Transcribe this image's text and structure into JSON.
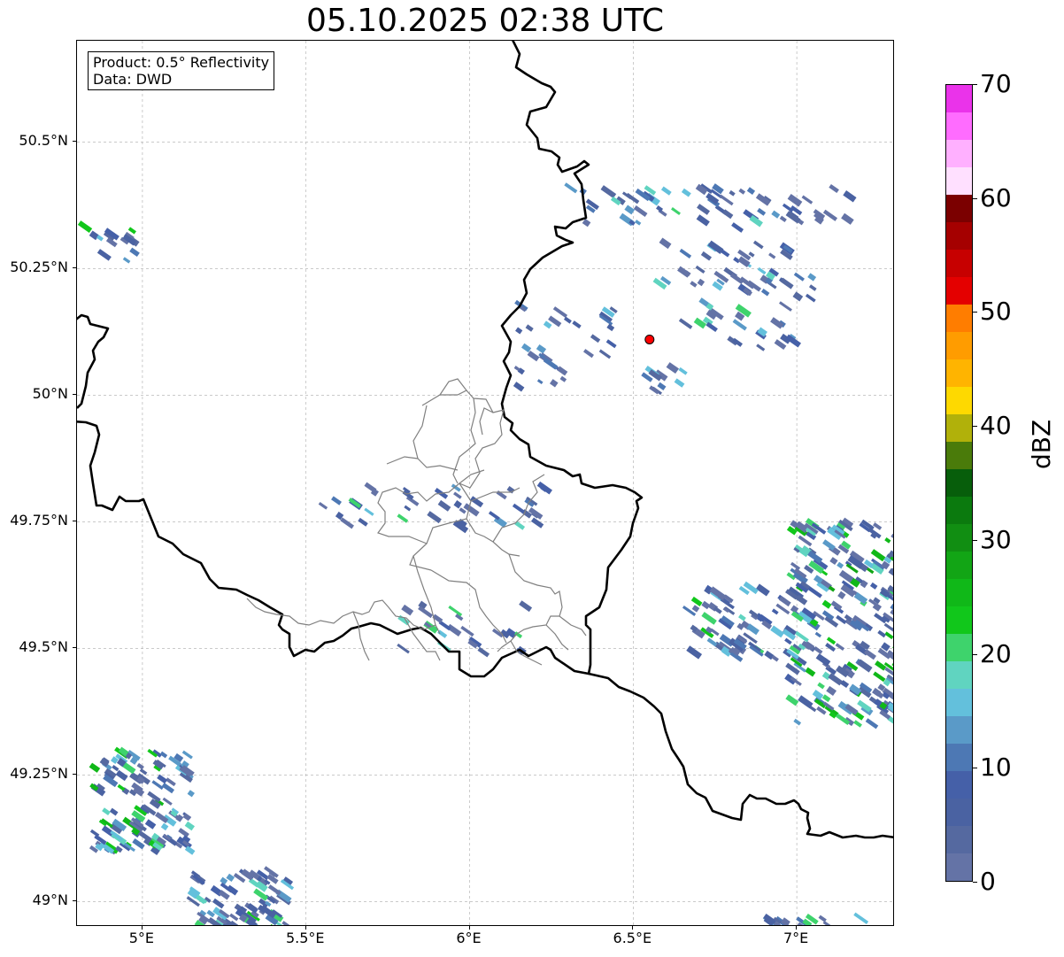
{
  "title": "05.10.2025 02:38 UTC",
  "info_box": {
    "product": "Product: 0.5° Reflectivity",
    "data": "Data: DWD"
  },
  "map_extent": {
    "lon_min": 4.8,
    "lon_max": 7.3,
    "lat_min": 48.95,
    "lat_max": 50.7
  },
  "lat_ticks": [
    {
      "value": 50.5,
      "label": "50.5°N"
    },
    {
      "value": 50.25,
      "label": "50.25°N"
    },
    {
      "value": 50.0,
      "label": "50°N"
    },
    {
      "value": 49.75,
      "label": "49.75°N"
    },
    {
      "value": 49.5,
      "label": "49.5°N"
    },
    {
      "value": 49.25,
      "label": "49.25°N"
    },
    {
      "value": 49.0,
      "label": "49°N"
    }
  ],
  "lon_ticks": [
    {
      "value": 5.0,
      "label": "5°E"
    },
    {
      "value": 5.5,
      "label": "5.5°E"
    },
    {
      "value": 6.0,
      "label": "6°E"
    },
    {
      "value": 6.5,
      "label": "6.5°E"
    },
    {
      "value": 7.0,
      "label": "7°E"
    }
  ],
  "radar_site": {
    "lon": 6.55,
    "lat": 50.11,
    "color": "#ff0000"
  },
  "colorbar": {
    "unit": "dBZ",
    "min": 0,
    "max": 70,
    "ticks": [
      {
        "value": 0,
        "label": "0"
      },
      {
        "value": 10,
        "label": "10"
      },
      {
        "value": 20,
        "label": "20"
      },
      {
        "value": 30,
        "label": "30"
      },
      {
        "value": 40,
        "label": "40"
      },
      {
        "value": 50,
        "label": "50"
      },
      {
        "value": 60,
        "label": "60"
      },
      {
        "value": 70,
        "label": "70"
      }
    ],
    "colors": [
      "#6473a6",
      "#5569a0",
      "#4a62a2",
      "#4560a8",
      "#4d78b4",
      "#5a9ac8",
      "#63c0dc",
      "#60d4c0",
      "#3ed36c",
      "#11c71b",
      "#10b818",
      "#12a515",
      "#118e12",
      "#0b7a0e",
      "#075e0b",
      "#4a7b0a",
      "#b1b10a",
      "#fed900",
      "#ffb400",
      "#ff9c00",
      "#ff7d00",
      "#e40000",
      "#c70000",
      "#a50000",
      "#7b0000",
      "#ffe0ff",
      "#ffb0ff",
      "#ff6cff",
      "#ea33ea"
    ]
  },
  "echo_clusters": [
    {
      "lon": 6.72,
      "lat": 50.37,
      "rlon": 0.45,
      "rlat": 0.04,
      "n": 60,
      "max_dbz": 22
    },
    {
      "lon": 6.78,
      "lat": 50.26,
      "rlon": 0.2,
      "rlat": 0.05,
      "n": 30,
      "max_dbz": 18
    },
    {
      "lon": 6.85,
      "lat": 50.17,
      "rlon": 0.2,
      "rlat": 0.08,
      "n": 40,
      "max_dbz": 22
    },
    {
      "lon": 6.3,
      "lat": 50.13,
      "rlon": 0.15,
      "rlat": 0.05,
      "n": 20,
      "max_dbz": 20
    },
    {
      "lon": 6.22,
      "lat": 50.05,
      "rlon": 0.08,
      "rlat": 0.04,
      "n": 12,
      "max_dbz": 20
    },
    {
      "lon": 6.6,
      "lat": 50.03,
      "rlon": 0.06,
      "rlat": 0.03,
      "n": 10,
      "max_dbz": 18
    },
    {
      "lon": 5.9,
      "lat": 49.78,
      "rlon": 0.35,
      "rlat": 0.04,
      "n": 40,
      "max_dbz": 22
    },
    {
      "lon": 5.0,
      "lat": 49.2,
      "rlon": 0.15,
      "rlat": 0.1,
      "n": 120,
      "max_dbz": 26
    },
    {
      "lon": 5.3,
      "lat": 49.0,
      "rlon": 0.15,
      "rlat": 0.06,
      "n": 80,
      "max_dbz": 26
    },
    {
      "lon": 7.15,
      "lat": 49.55,
      "rlon": 0.17,
      "rlat": 0.2,
      "n": 220,
      "max_dbz": 28
    },
    {
      "lon": 6.85,
      "lat": 49.55,
      "rlon": 0.18,
      "rlat": 0.07,
      "n": 80,
      "max_dbz": 22
    },
    {
      "lon": 4.9,
      "lat": 50.3,
      "rlon": 0.08,
      "rlat": 0.04,
      "n": 14,
      "max_dbz": 24
    },
    {
      "lon": 5.98,
      "lat": 49.54,
      "rlon": 0.2,
      "rlat": 0.05,
      "n": 25,
      "max_dbz": 22
    },
    {
      "lon": 7.05,
      "lat": 48.95,
      "rlon": 0.15,
      "rlat": 0.02,
      "n": 30,
      "max_dbz": 24
    }
  ]
}
